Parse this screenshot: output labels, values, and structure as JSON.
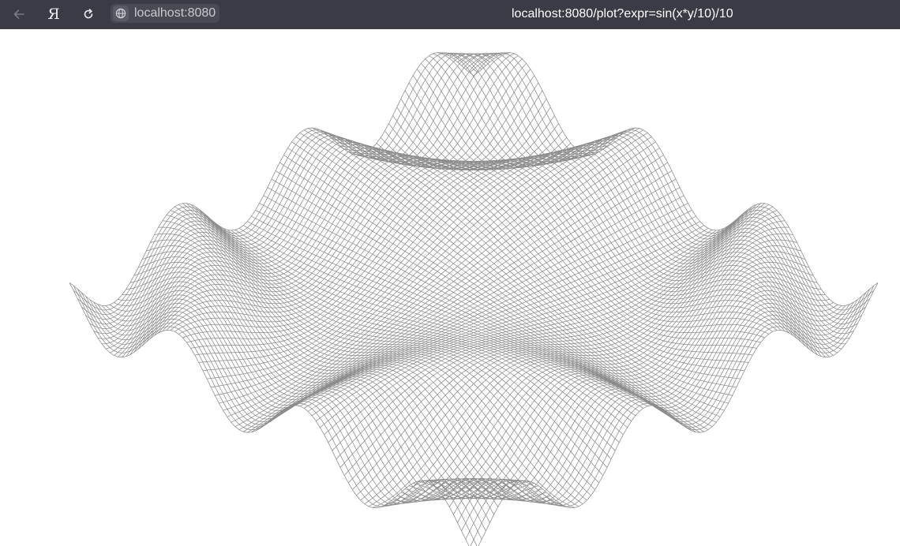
{
  "browser": {
    "address_host": "localhost:8080",
    "page_url": "localhost:8080/plot?expr=sin(x*y/10)/10",
    "icons": {
      "back": "arrow-left-icon",
      "yandex": "yandex-logo-icon",
      "reload": "reload-icon",
      "site_info": "globe-icon"
    },
    "colors": {
      "toolbar_bg": "#3b3b45",
      "page_bg": "#ffffff"
    }
  },
  "plot": {
    "expr": "sin(x*y/10)/10",
    "type": "wireframe-surface",
    "line_color": "#8c8c8c"
  }
}
